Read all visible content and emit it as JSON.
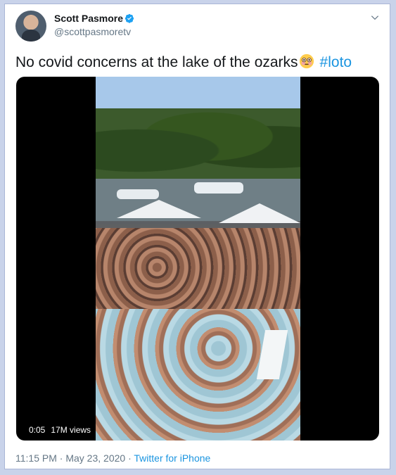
{
  "author": {
    "name": "Scott Pasmore",
    "handle": "@scottpasmoretv"
  },
  "tweet": {
    "text": "No covid concerns at the lake of the ozarks",
    "emoji": "flushed-face-emoji",
    "hashtag": "#loto"
  },
  "video": {
    "time": "0:05",
    "views": "17M views"
  },
  "meta": {
    "time": "11:15 PM",
    "separator1": " · ",
    "date": "May 23, 2020",
    "separator2": " · ",
    "source": "Twitter for iPhone"
  },
  "colors": {
    "link": "#1b95e0",
    "verified": "#1da1f2",
    "secondary_text": "#657786"
  }
}
